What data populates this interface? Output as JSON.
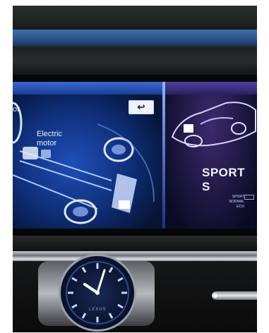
{
  "screen": {
    "back_button_symbol": "↩",
    "left_cut_text": "or",
    "motor_label": "Electric motor",
    "drive_mode_title": "SPORT S",
    "drive_modes": [
      "SPORT",
      "NORMAL",
      "ECO"
    ]
  },
  "clock": {
    "brand": "LEXUS"
  },
  "colors": {
    "screen_blue": "#1e4fb8",
    "screen_purple": "#3d2a6e",
    "chrome": "#c8cbd0"
  },
  "icons": {
    "back": "return-arrow-icon",
    "car": "car-outline-icon",
    "drivetrain": "hybrid-drivetrain-icon",
    "clock": "analog-clock-icon"
  }
}
